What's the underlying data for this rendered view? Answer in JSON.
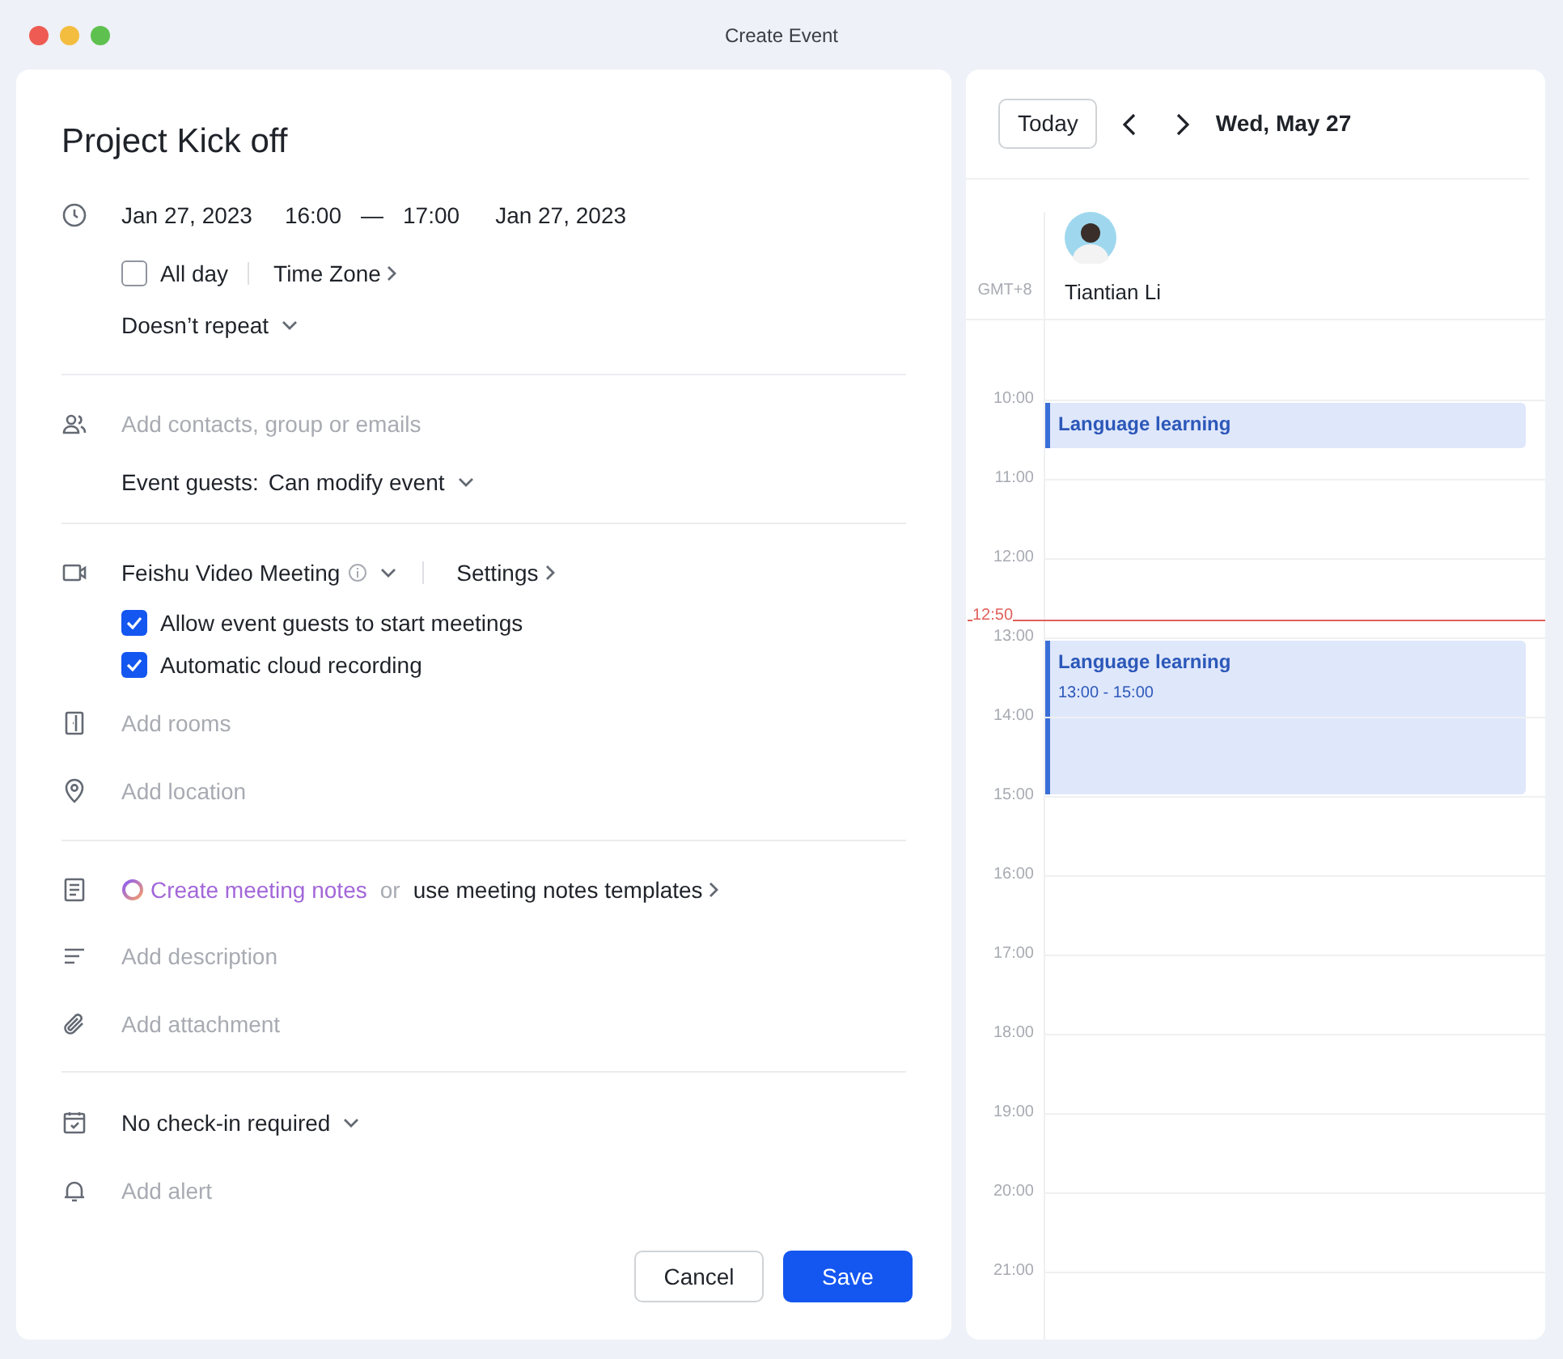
{
  "window": {
    "title": "Create Event"
  },
  "event": {
    "title": "Project Kick off",
    "time": {
      "start_date": "Jan 27, 2023",
      "start_time": "16:00",
      "dash": "—",
      "end_time": "17:00",
      "end_date": "Jan 27, 2023"
    },
    "all_day": {
      "label": "All day",
      "checked": false
    },
    "time_zone": "Time Zone",
    "repeat": "Doesn’t repeat",
    "guests": {
      "placeholder": "Add contacts, group or emails",
      "permission_label": "Event guests:",
      "permission": "Can modify event"
    },
    "video": {
      "provider": "Feishu Video Meeting",
      "settings": "Settings",
      "options": [
        {
          "label": "Allow event guests to start meetings",
          "checked": true
        },
        {
          "label": "Automatic cloud recording",
          "checked": true
        }
      ]
    },
    "rooms": {
      "placeholder": "Add rooms"
    },
    "location": {
      "placeholder": "Add location"
    },
    "notes": {
      "create": "Create meeting notes",
      "or": "or",
      "templates": "use meeting notes templates"
    },
    "description": {
      "placeholder": "Add description"
    },
    "attachment": {
      "placeholder": "Add attachment"
    },
    "check_in": "No check-in required",
    "alert": {
      "placeholder": "Add alert"
    },
    "buttons": [
      {
        "label": "Cancel",
        "kind": "secondary"
      },
      {
        "label": "Save",
        "kind": "primary"
      }
    ]
  },
  "calendar": {
    "today": "Today",
    "date": "Wed, May 27",
    "timezone": "GMT+8",
    "person": {
      "name": "Tiantian Li"
    },
    "hours": [
      {
        "label": "10:00",
        "events": [
          {
            "title": "Language learning",
            "kind": "short"
          }
        ]
      },
      {
        "label": "11:00"
      },
      {
        "label": "12:00",
        "now": "12:50"
      },
      {
        "label": "13:00",
        "events": [
          {
            "title": "Language learning",
            "time": "13:00 - 15:00",
            "kind": "block"
          }
        ]
      },
      {
        "label": "14:00"
      },
      {
        "label": "15:00"
      },
      {
        "label": "16:00"
      },
      {
        "label": "17:00"
      },
      {
        "label": "18:00"
      },
      {
        "label": "19:00"
      },
      {
        "label": "20:00"
      },
      {
        "label": "21:00"
      }
    ]
  }
}
